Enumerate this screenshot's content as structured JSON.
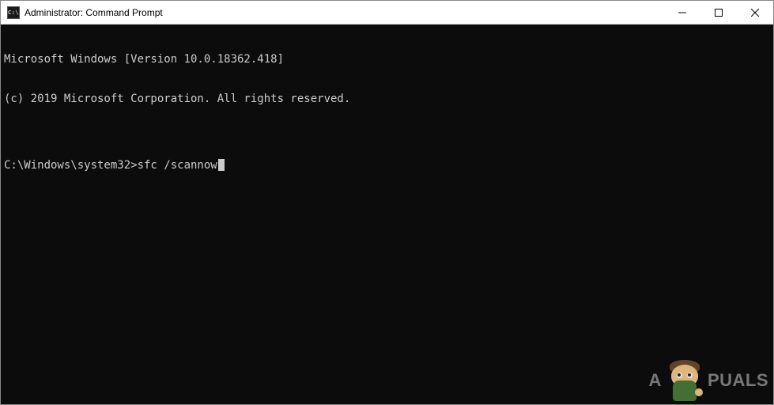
{
  "titlebar": {
    "icon_text": "C:\\",
    "title": "Administrator: Command Prompt"
  },
  "terminal": {
    "line1": "Microsoft Windows [Version 10.0.18362.418]",
    "line2": "(c) 2019 Microsoft Corporation. All rights reserved.",
    "blank": "",
    "prompt": "C:\\Windows\\system32>",
    "command": "sfc /scannow"
  },
  "watermark": {
    "prefix": "A",
    "suffix": "PUALS"
  }
}
